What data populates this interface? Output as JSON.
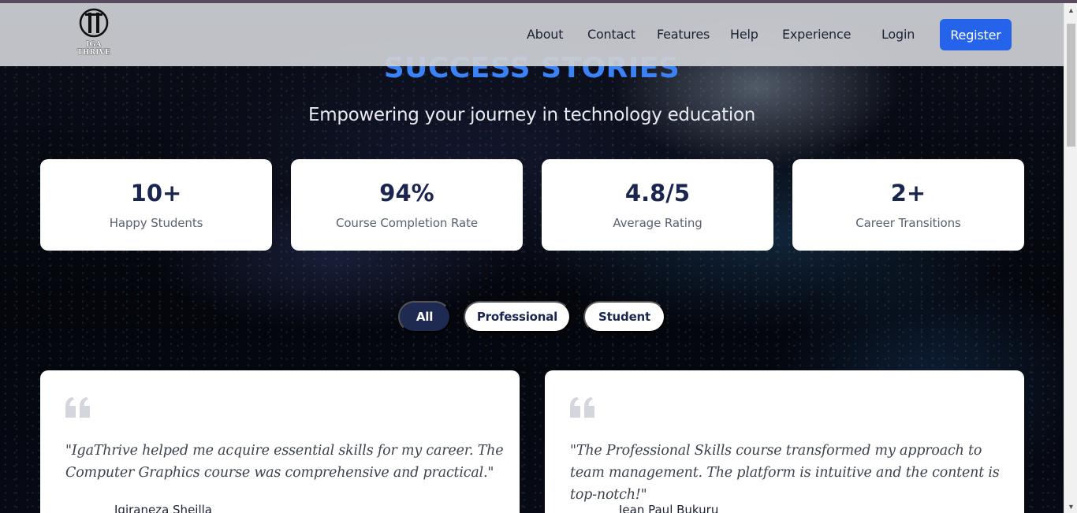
{
  "brand": {
    "logo_text": "IGA THRIVE"
  },
  "nav": {
    "links": [
      "About",
      "Contact",
      "Features",
      "Help",
      "Experience"
    ],
    "login": "Login",
    "register": "Register"
  },
  "hero": {
    "title": "SUCCESS STORIES",
    "subtitle": "Empowering your journey in technology education"
  },
  "stats": [
    {
      "value": "10+",
      "label": "Happy Students"
    },
    {
      "value": "94%",
      "label": "Course Completion Rate"
    },
    {
      "value": "4.8/5",
      "label": "Average Rating"
    },
    {
      "value": "2+",
      "label": "Career Transitions"
    }
  ],
  "filters": {
    "active": "All",
    "options": [
      "All",
      "Professional",
      "Student"
    ]
  },
  "testimonials": [
    {
      "quote": "\"IgaThrive helped me acquire essential skills for my career. The Computer Graphics course was comprehensive and practical.\"",
      "author": "Igiraneza Sheilla"
    },
    {
      "quote": "\"The Professional Skills course transformed my approach to team management. The platform is intuitive and the content is top-notch!\"",
      "author": "Jean Paul Bukuru"
    }
  ],
  "colors": {
    "accent": "#2563eb",
    "title_blue": "#3b82f6",
    "navy": "#1e2a52",
    "stat_text": "#1a2550"
  },
  "icons": {
    "quote": "quote-icon",
    "logo": "logo-icon"
  }
}
